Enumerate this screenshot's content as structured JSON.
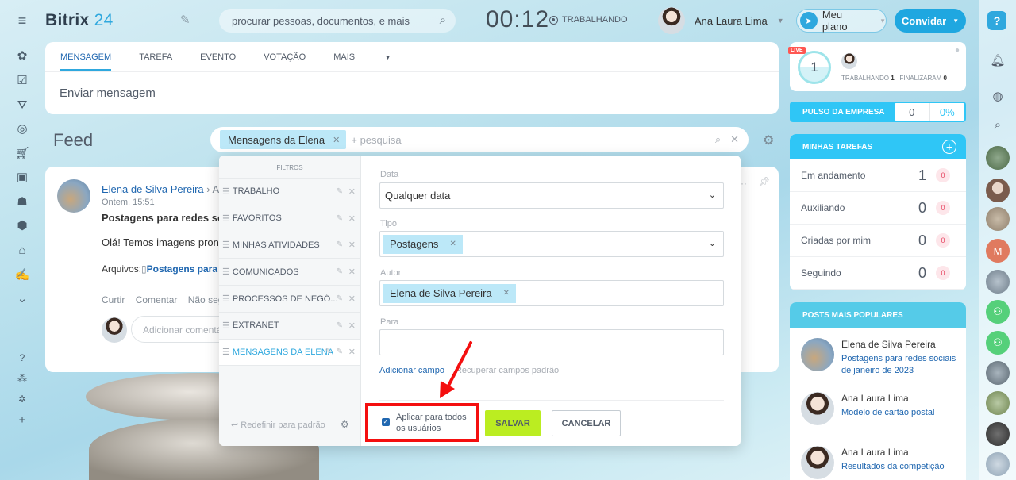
{
  "header": {
    "logo_main": "Bitrix",
    "logo_num": "24",
    "search_placeholder": "procurar pessoas, documentos, e mais",
    "clock": "00:12",
    "work_status": "TRABALHANDO",
    "user_name": "Ana Laura Lima",
    "plan_label": "Meu plano",
    "invite_label": "Convidar"
  },
  "composer": {
    "tabs": [
      "MENSAGEM",
      "TAREFA",
      "EVENTO",
      "VOTAÇÃO",
      "MAIS"
    ],
    "placeholder": "Enviar mensagem"
  },
  "feed": {
    "title": "Feed",
    "filter_chip": "Mensagens da Elena",
    "filter_placeholder": "+ pesquisa"
  },
  "post": {
    "author": "Elena de Silva Pereira",
    "recipient": "A t",
    "date": "Ontem, 15:51",
    "title": "Postagens para redes socia",
    "text": "Olá! Temos imagens pronta",
    "files_label": "Arquivos:",
    "file_name": "Postagens para r",
    "actions": [
      "Curtir",
      "Comentar",
      "Não segui"
    ],
    "comment_placeholder": "Adicionar comentá"
  },
  "filter_popup": {
    "header": "FILTROS",
    "presets": [
      "TRABALHO",
      "FAVORITOS",
      "MINHAS ATIVIDADES",
      "COMUNICADOS",
      "PROCESSOS DE NEGÓ...",
      "EXTRANET",
      "MENSAGENS DA ELENA"
    ],
    "reset_label": "Redefinir para padrão",
    "fields": {
      "date_label": "Data",
      "date_value": "Qualquer data",
      "type_label": "Tipo",
      "type_value": "Postagens",
      "author_label": "Autor",
      "author_value": "Elena de Silva Pereira",
      "to_label": "Para",
      "to_value": ""
    },
    "add_field": "Adicionar campo",
    "restore_fields": "Recuperar campos padrão",
    "apply_all_line1": "Aplicar para todos",
    "apply_all_line2": "os usuários",
    "save_label": "SALVAR",
    "cancel_label": "CANCELAR"
  },
  "live": {
    "tag": "LIVE",
    "count": "1",
    "working_label": "TRABALHANDO",
    "working_count": "1",
    "finished_label": "FINALIZARAM",
    "finished_count": "0"
  },
  "pulse": {
    "label": "PULSO DA EMPRESA",
    "value": "0",
    "percent": "0%"
  },
  "tasks": {
    "header": "MINHAS TAREFAS",
    "rows": [
      {
        "label": "Em andamento",
        "count": "1",
        "badge": "0"
      },
      {
        "label": "Auxiliando",
        "count": "0",
        "badge": "0"
      },
      {
        "label": "Criadas por mim",
        "count": "0",
        "badge": "0"
      },
      {
        "label": "Seguindo",
        "count": "0",
        "badge": "0"
      }
    ]
  },
  "popular": {
    "header": "POSTS MAIS POPULARES",
    "items": [
      {
        "name": "Elena de Silva Pereira",
        "title": "Postagens para redes sociais de janeiro de 2023"
      },
      {
        "name": "Ana Laura Lima",
        "title": "Modelo de cartão postal"
      },
      {
        "name": "Ana Laura Lima",
        "title": "Resultados da competição"
      }
    ]
  },
  "rightrail": {
    "help": "?",
    "avatar_letter": "M"
  },
  "colors": {
    "accent": "#2fa8de",
    "save_button": "#bbed21",
    "highlight": "#f40f0f",
    "pulse_bar": "#2fc6f6"
  }
}
